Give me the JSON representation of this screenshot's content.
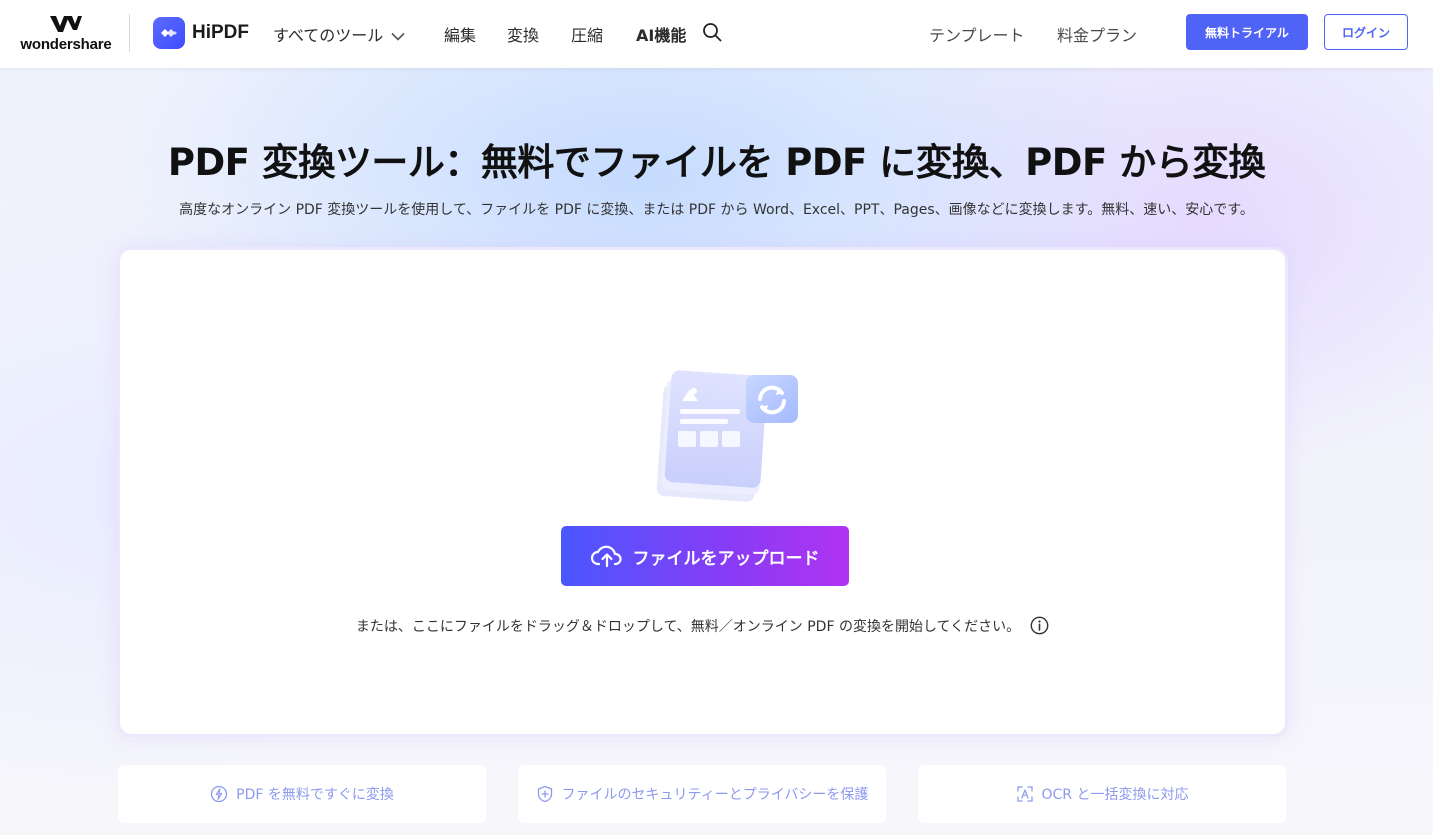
{
  "header": {
    "brand": "wondershare",
    "product": "HiPDF",
    "nav": {
      "all_tools": "すべてのツール",
      "edit": "編集",
      "convert": "変換",
      "compress": "圧縮",
      "ai": "AI機能"
    },
    "templates": "テンプレート",
    "pricing": "料金プラン",
    "trial_button": "無料トライアル",
    "login_button": "ログイン"
  },
  "hero": {
    "title": "PDF 変換ツール：無料でファイルを PDF に変換、PDF から変換",
    "subtitle": "高度なオンライン PDF 変換ツールを使用して、ファイルを PDF に変換、または PDF から Word、Excel、PPT、Pages、画像などに変換します。無料、速い、安心です。"
  },
  "upload": {
    "button_label": "ファイルをアップロード",
    "drop_hint": "または、ここにファイルをドラッグ＆ドロップして、無料／オンライン PDF の変換を開始してください。"
  },
  "features": [
    {
      "label": "PDF を無料ですぐに変換",
      "icon": "lightning-icon"
    },
    {
      "label": "ファイルのセキュリティーとプライバシーを保護",
      "icon": "shield-icon"
    },
    {
      "label": "OCR と一括変換に対応",
      "icon": "ocr-icon"
    }
  ],
  "colors": {
    "primary": "#4f63f6",
    "upload_gradient_start": "#4a57ff",
    "upload_gradient_end": "#b033f2",
    "feature_text": "#8c9af0"
  }
}
